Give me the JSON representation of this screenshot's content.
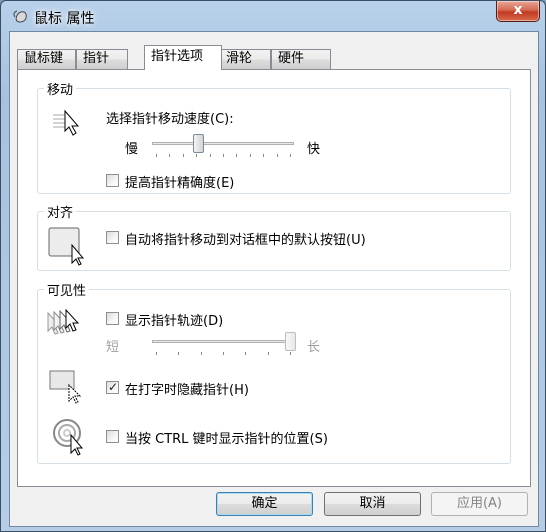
{
  "window": {
    "title": "鼠标 属性",
    "close_glyph": "x"
  },
  "tabs": [
    {
      "label": "鼠标键",
      "active": false
    },
    {
      "label": "指针",
      "active": false
    },
    {
      "label": "指针选项",
      "active": true
    },
    {
      "label": "滑轮",
      "active": false
    },
    {
      "label": "硬件",
      "active": false
    }
  ],
  "motion": {
    "group_label": "移动",
    "speed_label": "选择指针移动速度(C):",
    "slow_label": "慢",
    "fast_label": "快",
    "speed_value_fraction": 0.31,
    "precision": {
      "label": "提高指针精确度(E)",
      "checked": false
    }
  },
  "snap_to": {
    "group_label": "对齐",
    "auto_snap": {
      "label": "自动将指针移动到对话框中的默认按钮(U)",
      "checked": false
    }
  },
  "visibility": {
    "group_label": "可见性",
    "trails": {
      "label": "显示指针轨迹(D)",
      "checked": false
    },
    "short_label": "短",
    "long_label": "长",
    "trail_length_fraction": 1.0,
    "hide_while_typing": {
      "label": "在打字时隐藏指针(H)",
      "checked": true
    },
    "show_location": {
      "label": "当按 CTRL 键时显示指针的位置(S)",
      "checked": false
    }
  },
  "buttons": {
    "ok": "确定",
    "cancel": "取消",
    "apply": "应用(A)"
  },
  "icons": {
    "app": "mouse-icon",
    "speed": "fast-pointer-icon",
    "snap": "snap-to-button-icon",
    "trails": "pointer-trails-icon",
    "hide": "hide-pointer-icon",
    "locate": "locate-pointer-icon"
  }
}
